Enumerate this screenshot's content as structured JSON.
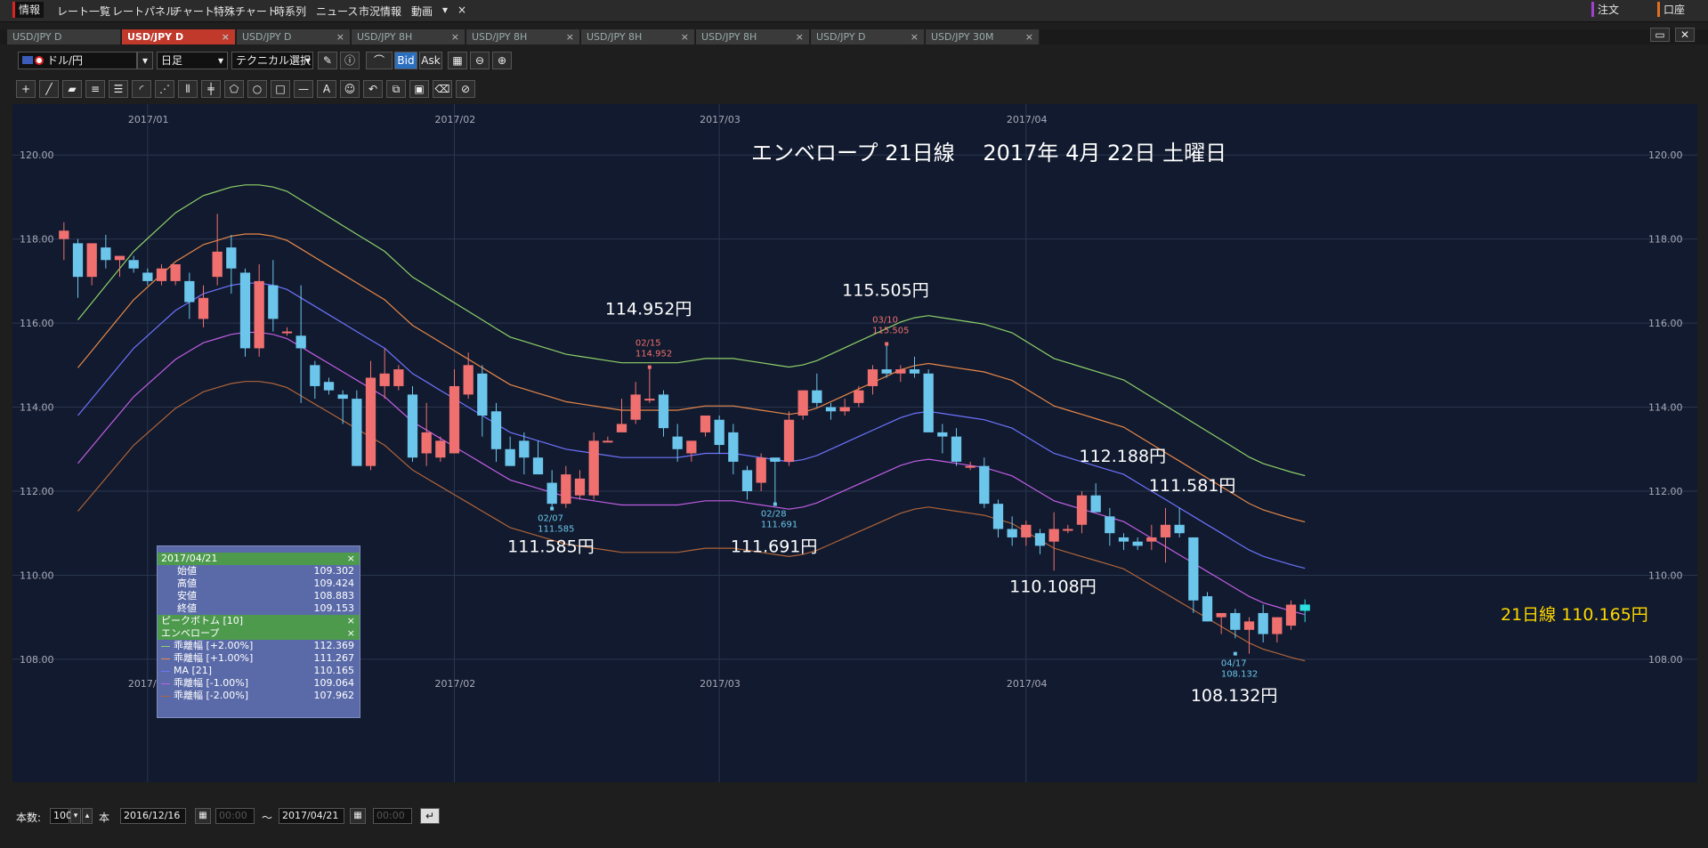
{
  "menubar": {
    "items": [
      "情報",
      "レート一覧",
      "レートパネル",
      "チャート",
      "特殊チャート",
      "時系列",
      "ニュース",
      "市況情報",
      "動画",
      "▾",
      "×"
    ],
    "right": [
      "注文",
      "口座"
    ]
  },
  "tabs": [
    "USD/JPY D",
    "USD/JPY D",
    "USD/JPY D",
    "USD/JPY 8H",
    "USD/JPY 8H",
    "USD/JPY 8H",
    "USD/JPY 8H",
    "USD/JPY D",
    "USD/JPY 30M"
  ],
  "toolbar": {
    "pair": "ドル/円",
    "period": "日足",
    "technical": "テクニカル選択",
    "bid": "Bid",
    "ask": "Ask"
  },
  "bottom": {
    "count_label": "本数:",
    "count": "100",
    "unit": "本",
    "from_date": "2016/12/16",
    "from_time": "00:00",
    "tilde": "〜",
    "to_date": "2017/04/21",
    "to_time": "00:00"
  },
  "info_panel": {
    "date": "2017/04/21",
    "ohlc": [
      {
        "label": "始値",
        "value": "109.302"
      },
      {
        "label": "高値",
        "value": "109.424"
      },
      {
        "label": "安値",
        "value": "108.883"
      },
      {
        "label": "終値",
        "value": "109.153"
      }
    ],
    "peak_label": "ピークボトム [10]",
    "envelope_label": "エンベロープ",
    "envelope_rows": [
      {
        "label": "乖離幅 [+2.00%]",
        "value": "112.369",
        "color": "#8fd16b"
      },
      {
        "label": "乖離幅 [+1.00%]",
        "value": "111.267",
        "color": "#e8884a"
      },
      {
        "label": "MA [21]",
        "value": "110.165",
        "color": "#6f73ff"
      },
      {
        "label": "乖離幅 [-1.00%]",
        "value": "109.064",
        "color": "#c25ee6"
      },
      {
        "label": "乖離幅 [-2.00%]",
        "value": "107.962",
        "color": "#b0643a"
      }
    ]
  },
  "chart_data": {
    "type": "candlestick",
    "title": "エンベロープ 21日線　 2017年 4月 22日 土曜日",
    "ylim": [
      106.6,
      121.0
    ],
    "yticks": [
      "120.00",
      "118.00",
      "116.00",
      "114.00",
      "112.00",
      "110.00",
      "108.00"
    ],
    "month_labels": [
      {
        "label": "2017/01",
        "index": 6
      },
      {
        "label": "2017/02",
        "index": 28
      },
      {
        "label": "2017/03",
        "index": 47
      },
      {
        "label": "2017/04",
        "index": 69
      }
    ],
    "colors": {
      "up": "#f07070",
      "down": "#6cc6ec",
      "last": "#2de0e0",
      "background": "#111a2e",
      "grid": "#2a3650"
    },
    "candles": [
      [
        118.0,
        118.4,
        117.5,
        118.2
      ],
      [
        117.9,
        118.0,
        116.6,
        117.1
      ],
      [
        117.1,
        117.9,
        116.9,
        117.9
      ],
      [
        117.8,
        118.1,
        117.3,
        117.5
      ],
      [
        117.5,
        117.6,
        117.1,
        117.6
      ],
      [
        117.5,
        117.6,
        117.2,
        117.3
      ],
      [
        117.2,
        117.3,
        116.9,
        117.0
      ],
      [
        117.0,
        117.4,
        116.9,
        117.3
      ],
      [
        117.0,
        117.3,
        116.9,
        117.4
      ],
      [
        117.0,
        117.2,
        116.1,
        116.5
      ],
      [
        116.1,
        116.9,
        115.9,
        116.6
      ],
      [
        117.1,
        118.6,
        116.9,
        117.7
      ],
      [
        117.8,
        118.1,
        116.7,
        117.3
      ],
      [
        117.2,
        117.3,
        115.2,
        115.4
      ],
      [
        115.4,
        117.4,
        115.2,
        117.0
      ],
      [
        116.9,
        117.5,
        115.8,
        116.1
      ],
      [
        115.8,
        115.9,
        115.7,
        115.8
      ],
      [
        115.7,
        116.9,
        114.1,
        115.4
      ],
      [
        115.0,
        115.1,
        114.2,
        114.5
      ],
      [
        114.6,
        114.7,
        114.3,
        114.4
      ],
      [
        114.3,
        114.4,
        113.6,
        114.2
      ],
      [
        114.2,
        114.4,
        112.6,
        112.6
      ],
      [
        112.6,
        115.1,
        112.5,
        114.7
      ],
      [
        114.5,
        115.4,
        114.2,
        114.8
      ],
      [
        114.5,
        115.0,
        114.4,
        114.9
      ],
      [
        114.3,
        114.5,
        112.7,
        112.8
      ],
      [
        112.9,
        114.1,
        112.6,
        113.4
      ],
      [
        112.8,
        113.3,
        112.7,
        113.2
      ],
      [
        112.9,
        114.9,
        112.9,
        114.5
      ],
      [
        114.3,
        115.3,
        114.2,
        115.0
      ],
      [
        114.8,
        115.0,
        113.3,
        113.8
      ],
      [
        113.9,
        114.1,
        112.7,
        113.0
      ],
      [
        113.0,
        113.3,
        112.6,
        112.6
      ],
      [
        113.2,
        113.4,
        112.4,
        112.8
      ],
      [
        112.8,
        113.2,
        112.6,
        112.4
      ],
      [
        112.2,
        112.5,
        111.6,
        111.7
      ],
      [
        111.7,
        112.6,
        111.6,
        112.4
      ],
      [
        111.9,
        112.5,
        111.8,
        112.3
      ],
      [
        111.9,
        113.4,
        111.8,
        113.2
      ],
      [
        113.2,
        113.3,
        113.2,
        113.2
      ],
      [
        113.4,
        114.2,
        113.4,
        113.6
      ],
      [
        113.7,
        114.6,
        113.6,
        114.3
      ],
      [
        114.2,
        114.952,
        114.1,
        114.2
      ],
      [
        114.3,
        114.4,
        113.3,
        113.5
      ],
      [
        113.3,
        113.6,
        112.7,
        113.0
      ],
      [
        112.9,
        113.2,
        112.7,
        113.2
      ],
      [
        113.4,
        113.7,
        113.3,
        113.8
      ],
      [
        113.7,
        113.8,
        112.9,
        113.1
      ],
      [
        113.4,
        113.6,
        112.4,
        112.7
      ],
      [
        112.5,
        112.6,
        111.8,
        112.0
      ],
      [
        112.2,
        112.9,
        112.0,
        112.8
      ],
      [
        112.8,
        112.8,
        111.691,
        112.7
      ],
      [
        112.7,
        113.9,
        112.6,
        113.7
      ],
      [
        113.8,
        114.4,
        113.7,
        114.4
      ],
      [
        114.4,
        114.8,
        114.0,
        114.1
      ],
      [
        114.0,
        114.1,
        113.7,
        113.9
      ],
      [
        113.9,
        114.2,
        113.8,
        114.0
      ],
      [
        114.1,
        114.5,
        114.0,
        114.4
      ],
      [
        114.5,
        115.0,
        114.3,
        114.9
      ],
      [
        114.9,
        115.505,
        114.7,
        114.8
      ],
      [
        114.8,
        115.0,
        114.6,
        114.9
      ],
      [
        114.9,
        115.2,
        114.7,
        114.8
      ],
      [
        114.8,
        114.9,
        113.5,
        113.4
      ],
      [
        113.4,
        113.6,
        112.9,
        113.3
      ],
      [
        113.3,
        113.5,
        112.6,
        112.7
      ],
      [
        112.6,
        112.7,
        112.5,
        112.6
      ],
      [
        112.6,
        112.8,
        111.6,
        111.7
      ],
      [
        111.7,
        111.8,
        110.9,
        111.1
      ],
      [
        111.1,
        111.4,
        110.7,
        110.9
      ],
      [
        110.9,
        111.3,
        110.7,
        111.2
      ],
      [
        111.0,
        111.1,
        110.5,
        110.7
      ],
      [
        110.8,
        111.5,
        110.108,
        111.1
      ],
      [
        111.1,
        111.2,
        111.0,
        111.1
      ],
      [
        111.2,
        112.0,
        111.0,
        111.9
      ],
      [
        111.9,
        112.188,
        111.5,
        111.5
      ],
      [
        111.4,
        111.6,
        110.7,
        111.0
      ],
      [
        110.9,
        111.0,
        110.6,
        110.8
      ],
      [
        110.8,
        110.9,
        110.6,
        110.7
      ],
      [
        110.8,
        111.2,
        110.6,
        110.9
      ],
      [
        110.9,
        111.6,
        110.3,
        111.2
      ],
      [
        111.2,
        111.6,
        110.9,
        111.0
      ],
      [
        110.9,
        110.9,
        109.1,
        109.4
      ],
      [
        109.5,
        109.6,
        108.9,
        108.9
      ],
      [
        109.0,
        109.1,
        108.6,
        109.1
      ],
      [
        109.1,
        109.2,
        108.5,
        108.7
      ],
      [
        108.7,
        109.0,
        108.132,
        108.9
      ],
      [
        109.1,
        109.3,
        108.4,
        108.6
      ],
      [
        108.6,
        109.0,
        108.4,
        109.0
      ],
      [
        108.8,
        109.4,
        108.7,
        109.3
      ],
      [
        109.302,
        109.424,
        108.883,
        109.153
      ]
    ],
    "envelope": {
      "ma21": [
        113.8,
        114.2,
        114.6,
        115.0,
        115.4,
        115.7,
        116.0,
        116.3,
        116.5,
        116.7,
        116.8,
        116.9,
        116.95,
        116.95,
        116.9,
        116.8,
        116.6,
        116.4,
        116.2,
        116.0,
        115.8,
        115.6,
        115.4,
        115.1,
        114.8,
        114.6,
        114.4,
        114.2,
        114.0,
        113.8,
        113.6,
        113.4,
        113.3,
        113.2,
        113.1,
        113.0,
        112.95,
        112.9,
        112.85,
        112.8,
        112.8,
        112.8,
        112.8,
        112.8,
        112.85,
        112.9,
        112.9,
        112.9,
        112.85,
        112.8,
        112.75,
        112.7,
        112.75,
        112.85,
        113.0,
        113.15,
        113.3,
        113.45,
        113.6,
        113.75,
        113.85,
        113.9,
        113.85,
        113.8,
        113.75,
        113.7,
        113.6,
        113.5,
        113.3,
        113.1,
        112.9,
        112.8,
        112.7,
        112.6,
        112.5,
        112.4,
        112.2,
        112.0,
        111.8,
        111.6,
        111.4,
        111.2,
        111.0,
        110.8,
        110.6,
        110.45,
        110.35,
        110.25,
        110.165
      ],
      "dev_pct": [
        2,
        1,
        -1,
        -2
      ],
      "colors": [
        "#8fd16b",
        "#e8884a",
        "#6f73ff",
        "#c25ee6",
        "#b0643a"
      ]
    },
    "annotations": [
      {
        "index": 35,
        "price": "111.585",
        "date": "02/07",
        "pos": "below",
        "big": "111.585円",
        "big_price": 110.55
      },
      {
        "index": 42,
        "price": "114.952",
        "date": "02/15",
        "pos": "above",
        "big": "114.952円",
        "big_price": 116.2
      },
      {
        "index": 51,
        "price": "111.691",
        "date": "02/28",
        "pos": "below",
        "big": "111.691円",
        "big_price": 110.55
      },
      {
        "index": 59,
        "price": "115.505",
        "date": "03/10",
        "pos": "above",
        "big": "115.505円",
        "big_price": 116.65
      },
      {
        "index": 84,
        "price": "108.132",
        "date": "04/17",
        "pos": "below",
        "big": "108.132円",
        "big_price": 107.0
      }
    ],
    "big_labels": [
      {
        "text": "110.108円",
        "index": 71,
        "price": 109.6
      },
      {
        "text": "112.188円",
        "index": 76,
        "price": 112.7
      },
      {
        "text": "111.581円",
        "index": 81,
        "price": 112.0
      }
    ],
    "ma_label": "21日線 110.165円"
  }
}
